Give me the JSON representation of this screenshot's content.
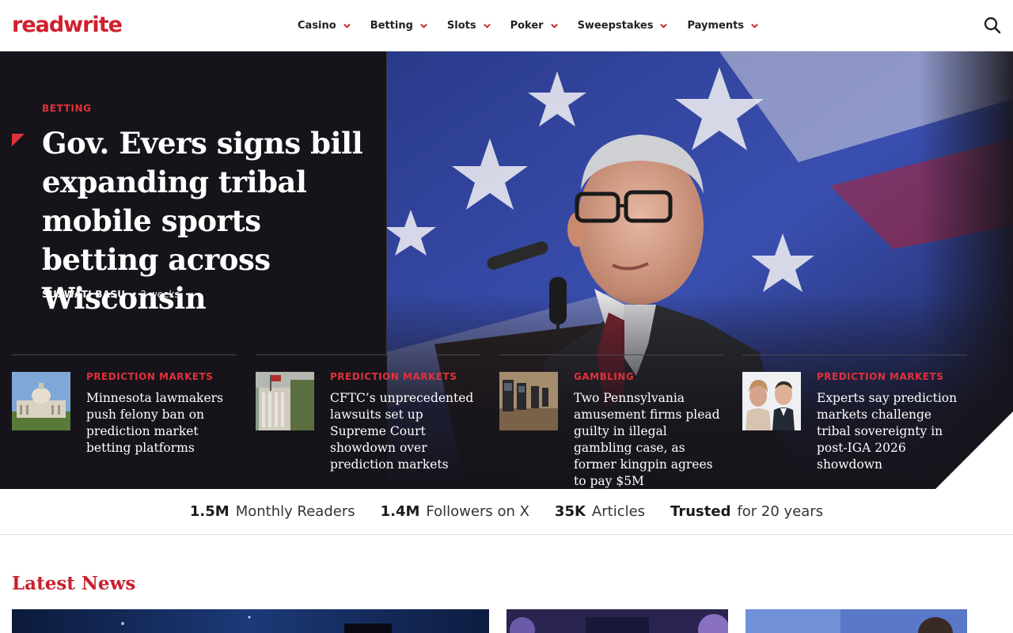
{
  "header": {
    "logo": "readwrite",
    "nav": [
      {
        "label": "Casino"
      },
      {
        "label": "Betting"
      },
      {
        "label": "Slots"
      },
      {
        "label": "Poker"
      },
      {
        "label": "Sweepstakes"
      },
      {
        "label": "Payments"
      }
    ],
    "search_icon": "search-icon"
  },
  "hero": {
    "category": "BETTING",
    "title": "Gov. Evers signs bill expanding tribal mobile sports betting across Wisconsin",
    "author": "SUSWATI BASU",
    "time": "2 weeks",
    "dot": "•"
  },
  "sub_articles": [
    {
      "category": "PREDICTION MARKETS",
      "title": "Minnesota lawmakers push felony ban on prediction market betting platforms"
    },
    {
      "category": "PREDICTION MARKETS",
      "title": "CFTC’s unprecedented lawsuits set up Supreme Court showdown over prediction markets"
    },
    {
      "category": "GAMBLING",
      "title": "Two Pennsylvania amusement firms plead guilty in illegal gambling case, as former kingpin agrees to pay $5M"
    },
    {
      "category": "PREDICTION MARKETS",
      "title": "Experts say prediction markets challenge tribal sovereignty in post-IGA 2026 showdown"
    }
  ],
  "stats": [
    {
      "value": "1.5M",
      "label": "Monthly Readers"
    },
    {
      "value": "1.4M",
      "label": "Followers on X"
    },
    {
      "value": "35K",
      "label": "Articles"
    },
    {
      "value": "Trusted",
      "label": "for 20 years"
    }
  ],
  "latest": {
    "title": "Latest News"
  },
  "colors": {
    "accent": "#d11f2d",
    "hero_bg": "#16141a",
    "category": "#e0313b"
  }
}
